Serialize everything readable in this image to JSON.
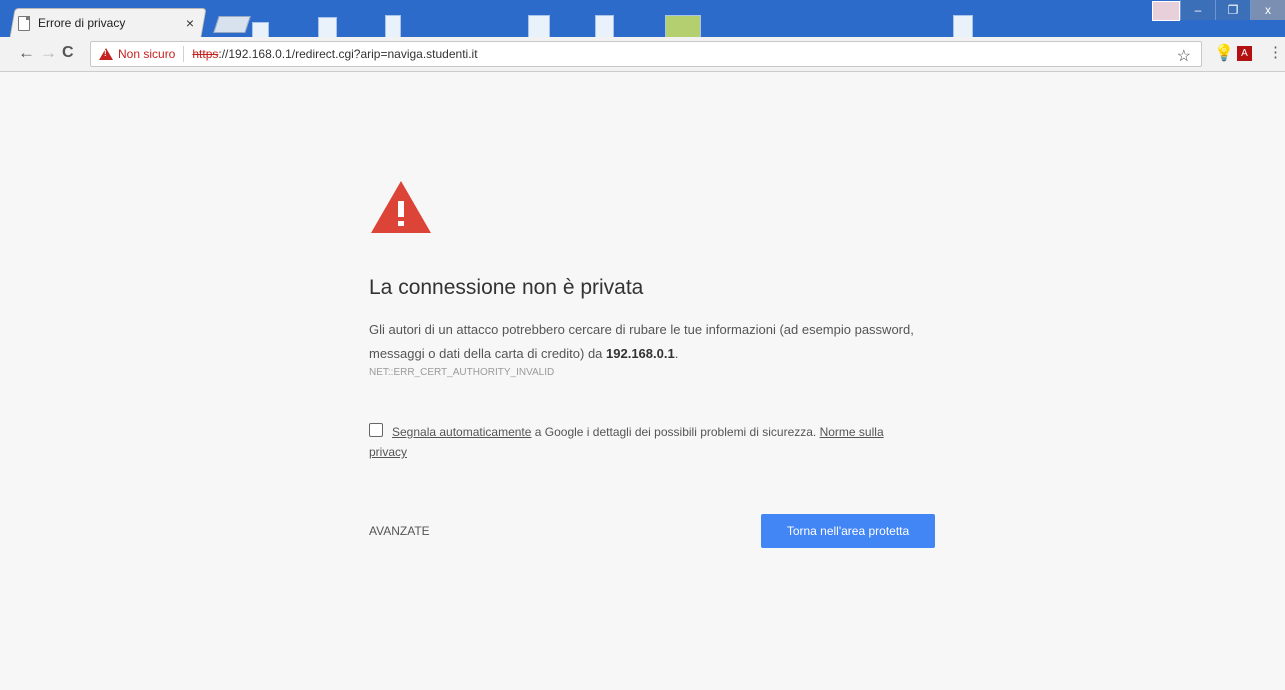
{
  "tab": {
    "title": "Errore di privacy",
    "close": "×"
  },
  "window": {
    "minimize": "–",
    "maximize": "❐",
    "close": "x"
  },
  "toolbar": {
    "back": "←",
    "forward": "→",
    "reload": "C"
  },
  "omnibox": {
    "security_label": "Non sicuro",
    "scheme": "https",
    "url_rest": "://192.168.0.1/redirect.cgi?arip=naviga.studenti.it"
  },
  "extensions": {
    "star": "☆",
    "bulb": "💡",
    "pdf": "A",
    "menu": "⋮"
  },
  "page": {
    "heading": "La connessione non è privata",
    "description_prefix": "Gli autori di un attacco potrebbero cercare di rubare le tue informazioni (ad esempio password, messaggi o dati della carta di credito) da ",
    "host": "192.168.0.1",
    "description_suffix": ".",
    "error_code": "NET::ERR_CERT_AUTHORITY_INVALID",
    "report_link": "Segnala automaticamente",
    "report_text": " a Google i dettagli dei possibili problemi di sicurezza. ",
    "privacy_link_part1": "Norme sulla",
    "privacy_link_part2": "privacy",
    "advanced": "AVANZATE",
    "back_button": "Torna nell'area protetta"
  },
  "colors": {
    "accent": "#4285f4",
    "warning": "#db4437",
    "insecure_text": "#c5221f"
  }
}
